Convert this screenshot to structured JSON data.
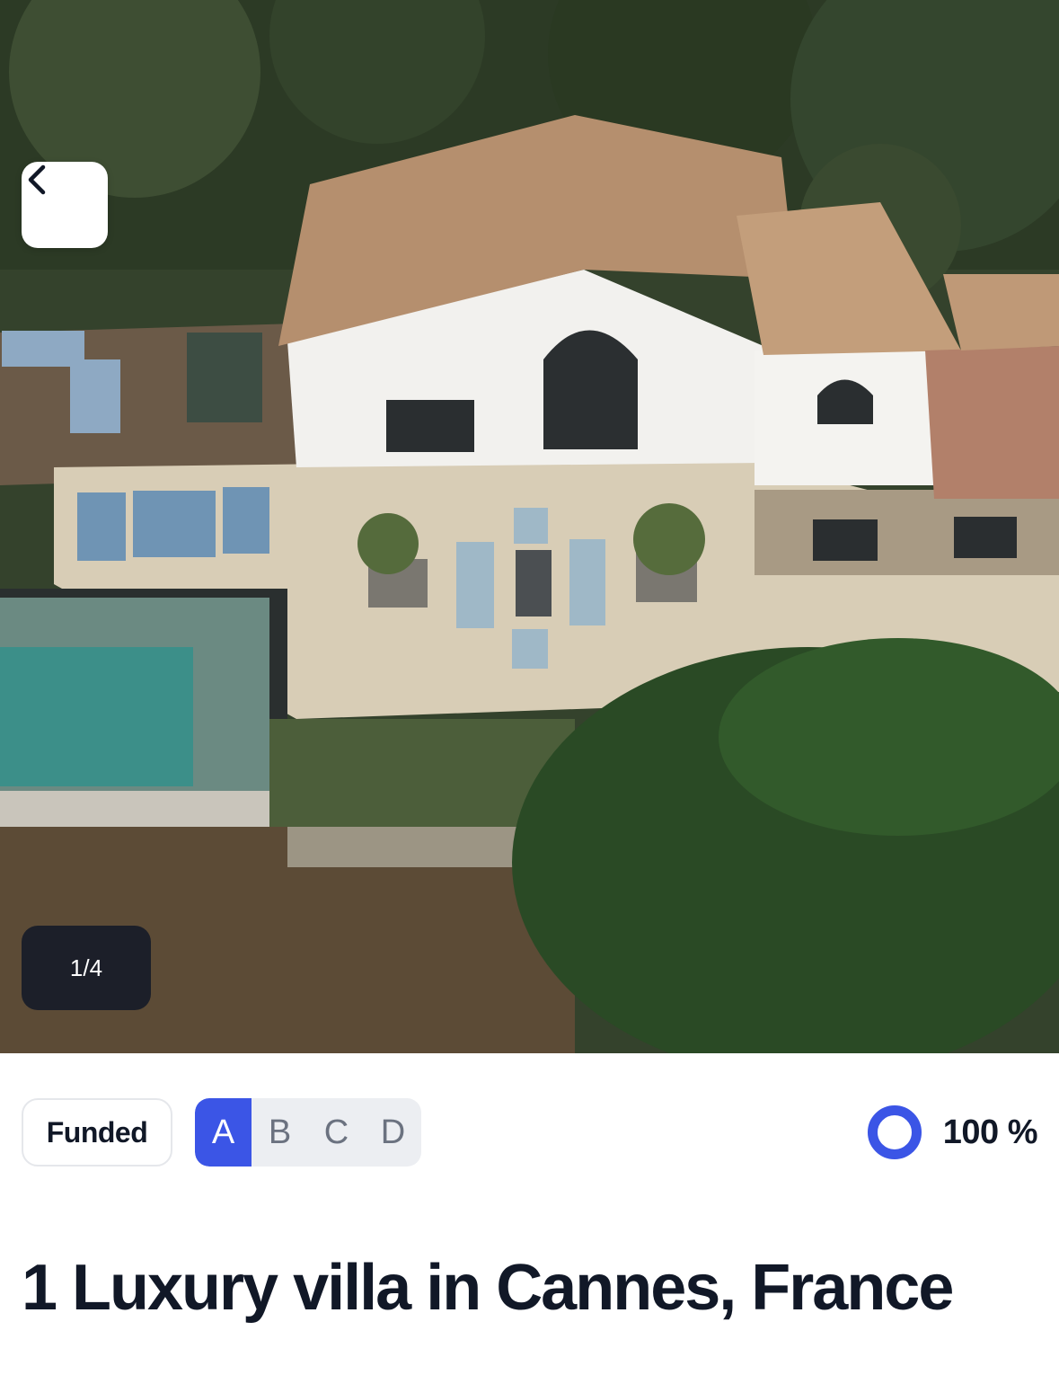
{
  "gallery": {
    "counter": "1/4",
    "back_icon": "chevron-left-icon"
  },
  "status": {
    "badge": "Funded",
    "grades": [
      "A",
      "B",
      "C",
      "D"
    ],
    "selected_grade": "A",
    "progress_label": "100 %",
    "progress_value": 100
  },
  "listing": {
    "title": "1 Luxury villa in Cannes, France"
  },
  "colors": {
    "accent": "#3b55e6",
    "text": "#111827"
  }
}
